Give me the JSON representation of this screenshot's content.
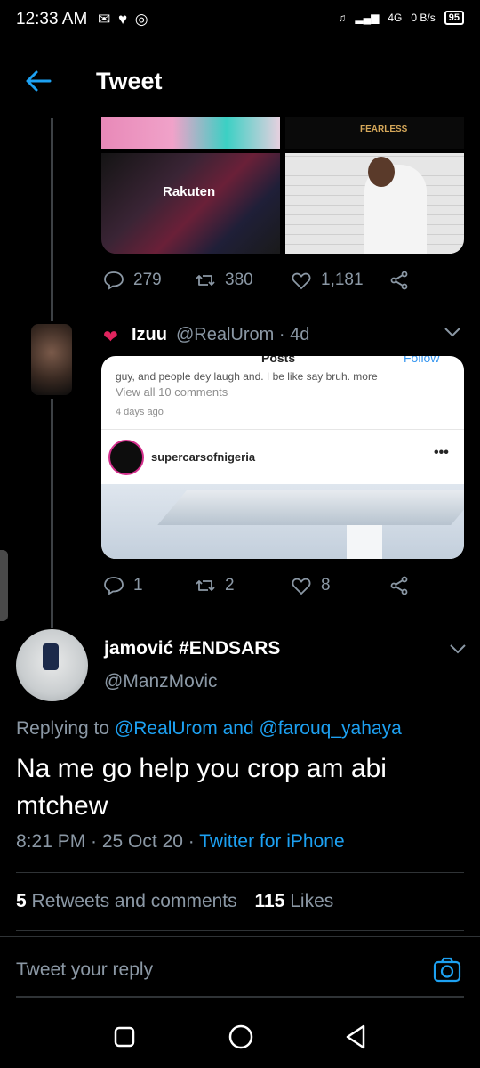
{
  "status_bar": {
    "time": "12:33 AM",
    "network": "4G",
    "speed": "0 B/s",
    "battery": "95"
  },
  "header": {
    "title": "Tweet"
  },
  "tweet1_actions": {
    "replies": "279",
    "retweets": "380",
    "likes": "1,181"
  },
  "reply1": {
    "name": "Izuu",
    "handle_time": "@RealUrom · 4d",
    "embed": {
      "posts_label": "Posts",
      "follow_label": "Follow",
      "truncated": "guy, and people dey laugh and. I be like say bruh. more",
      "comments": "View all 10 comments",
      "ago": "4 days ago",
      "username": "supercarsofnigeria",
      "more": "•••"
    },
    "actions": {
      "replies": "1",
      "retweets": "2",
      "likes": "8"
    }
  },
  "main_tweet": {
    "name": "jamović #ENDSARS",
    "handle": "@ManzMovic",
    "replying_prefix": "Replying to",
    "replying_user1": "@RealUrom",
    "replying_and": "and",
    "replying_user2": "@farouq_yahaya",
    "text": "Na me go help you crop am abi mtchew",
    "time": "8:21 PM · 25 Oct 20 ·",
    "source": "Twitter for iPhone",
    "retweets_count": "5",
    "retweets_label": "Retweets and comments",
    "likes_count": "115",
    "likes_label": "Likes"
  },
  "reply_box": {
    "placeholder": "Tweet your reply"
  },
  "colors": {
    "accent": "#1da1f2",
    "muted": "#8b98a5",
    "like_red": "#e0245e"
  }
}
